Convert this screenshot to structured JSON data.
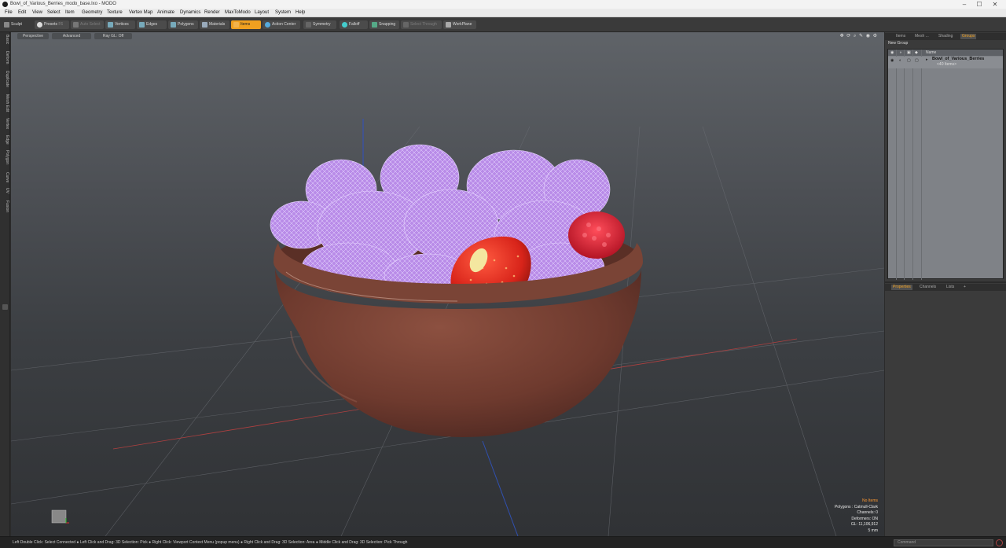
{
  "window": {
    "title": "Bowl_of_Various_Berries_modo_base.lxo - MODO",
    "min": "–",
    "max": "☐",
    "close": "✕"
  },
  "menu": [
    "File",
    "Edit",
    "View",
    "Select",
    "Item",
    "Geometry",
    "Texture",
    "Vertex Map",
    "Animate",
    "Dynamics",
    "Render",
    "MaxToModo",
    "Layout",
    "System",
    "Help"
  ],
  "toolbar": {
    "sculpt": "Sculpt",
    "presets": "Presets",
    "presets_key": "F6",
    "auto_select": "Auto Select",
    "vertices": "Vertices",
    "edges": "Edges",
    "polygons": "Polygons",
    "materials": "Materials",
    "items": "Items",
    "action_center": "Action Center",
    "symmetry": "Symmetry",
    "falloff": "Falloff",
    "snapping": "Snapping",
    "select_through": "Select Through",
    "workplane": "WorkPlane"
  },
  "side_tabs": [
    "Basic",
    "Deform",
    "Duplicate",
    "Mesh Edit",
    "Vertex",
    "Edge",
    "Polygon",
    "Curve",
    "UV",
    "Fusion"
  ],
  "viewport": {
    "view": "Perspective",
    "style": "Advanced",
    "ray_gl": "Ray GL: Off",
    "info": {
      "items": "No Items",
      "polygons": "Polygons : Catmull-Clark",
      "channels": "Channels: 0",
      "deformers": "Deformers: ON",
      "gl": "GL: 11,106,912",
      "unit": "5 mm"
    }
  },
  "groups_panel": {
    "tabs": [
      "Items",
      "Mesh ...",
      "Shading",
      "Groups"
    ],
    "new_group": "New Group",
    "col_name": "Name",
    "group_name": "Bowl_of_Various_Berries",
    "group_items": "<40 Items>"
  },
  "props_panel": {
    "tabs": [
      "Properties",
      "Channels",
      "Lists"
    ],
    "add": "+"
  },
  "status": {
    "message": "Left Double Click: Select Connected ● Left Click and Drag: 3D Selection: Pick ● Right Click: Viewport Context Menu (popup menu) ● Right Click and Drag: 3D Selection: Area ● Middle Click and Drag: 3D Selection: Pick Through",
    "command_placeholder": "Command"
  },
  "colors": {
    "accent": "#f0a020",
    "wire": "#c49af2",
    "bowl": "#7b4436",
    "strawberry": "#e02a1c"
  }
}
